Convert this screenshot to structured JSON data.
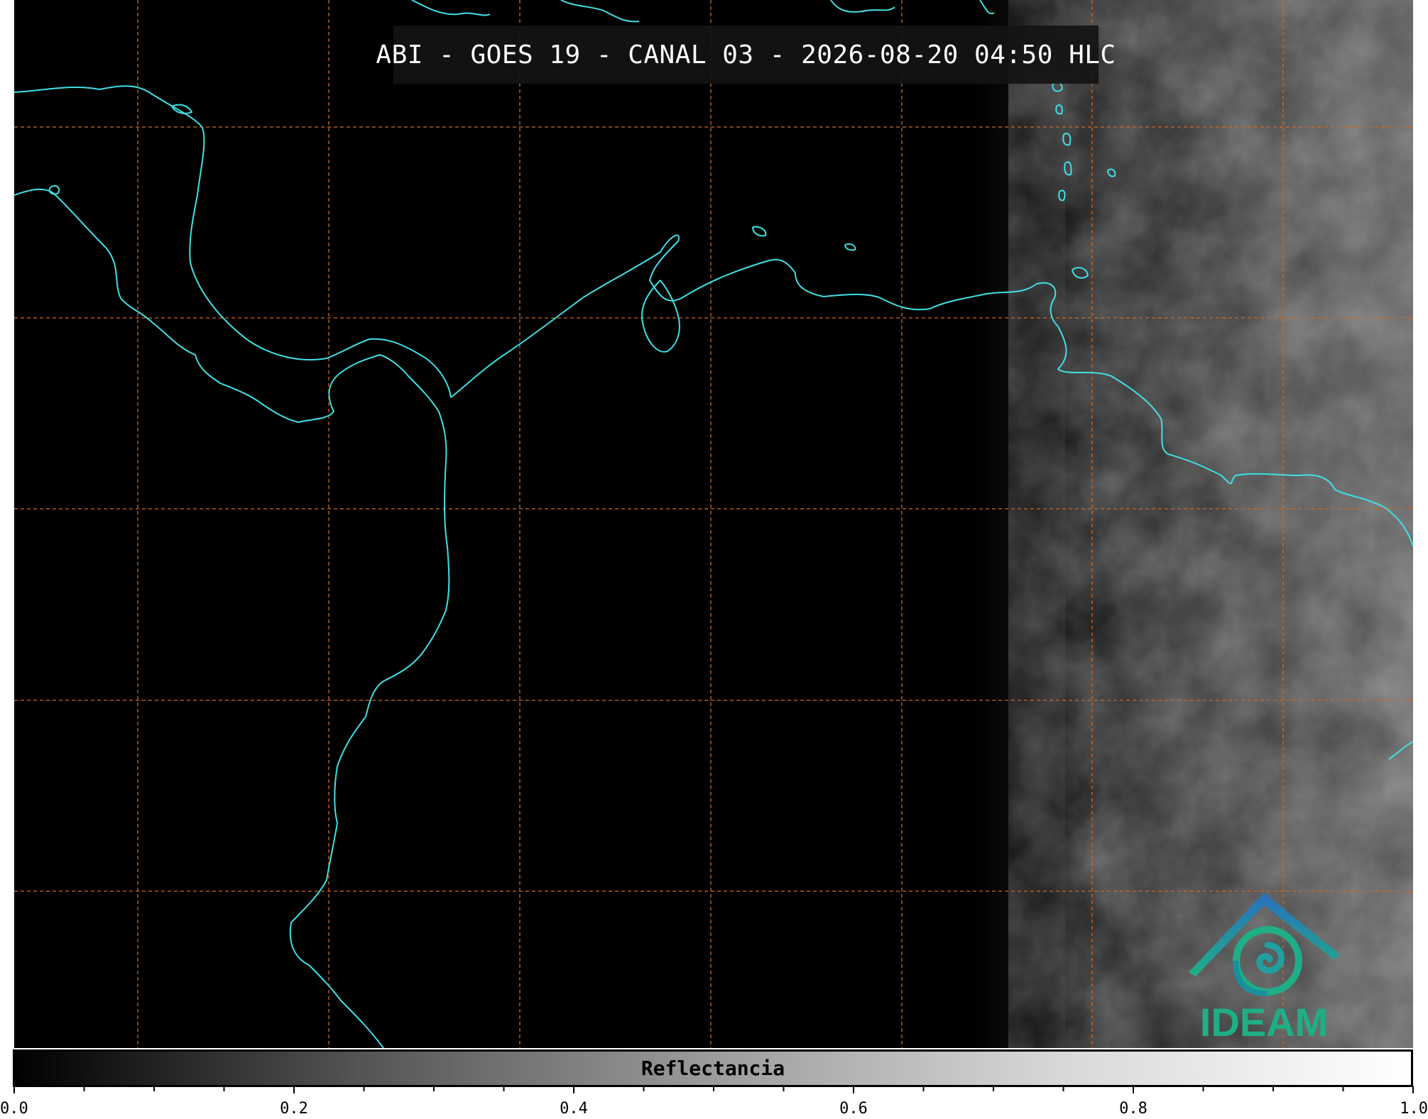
{
  "title": "ABI - GOES 19 - CANAL 03 - 2026-08-20 04:50 HLC",
  "colorbar": {
    "label": "Reflectancia",
    "range": [
      0.0,
      1.0
    ],
    "tick_labels": [
      "0.0",
      "0.2",
      "0.4",
      "0.6",
      "0.8",
      "1.0"
    ],
    "colors": [
      "#000000",
      "#ffffff"
    ]
  },
  "logo": {
    "text": "IDEAM",
    "colors": {
      "roof": "#2a6fbf",
      "swirl": "#1fae86"
    }
  },
  "map": {
    "background": "#000000",
    "coastline_color": "#40e0e6",
    "grid_color": "#d2691e",
    "grid_style": "dashed"
  }
}
